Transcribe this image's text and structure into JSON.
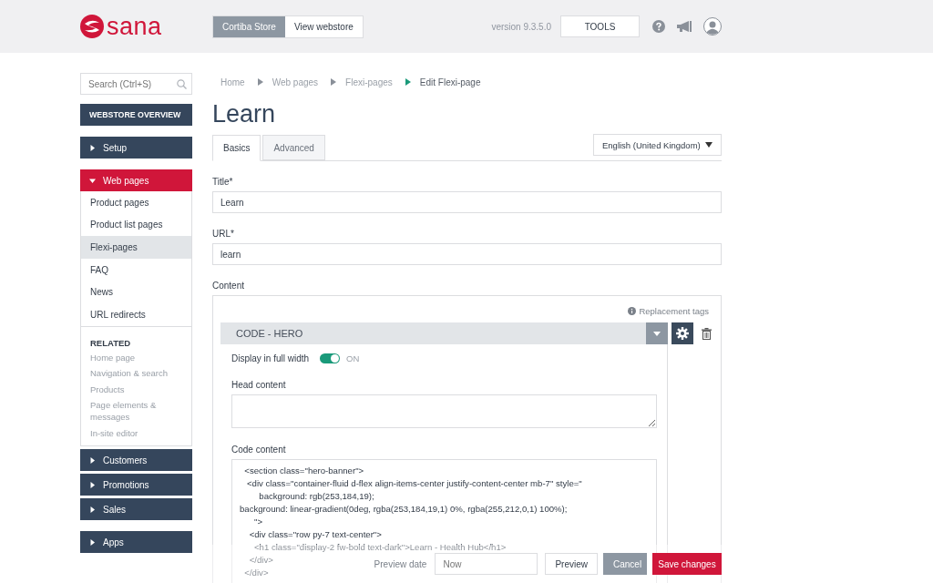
{
  "header": {
    "logo": "sana",
    "store_switch": [
      {
        "label": "Cortiba Store",
        "selected": true
      },
      {
        "label": "View webstore",
        "selected": false
      }
    ],
    "version": "version 9.3.5.0",
    "tools": "TOOLS"
  },
  "sidebar": {
    "search": {
      "placeholder": "Search (Ctrl+S)"
    },
    "overview": "WEBSTORE OVERVIEW",
    "sections": [
      {
        "label": "Setup",
        "expanded": false
      },
      {
        "label": "Web pages",
        "expanded": true,
        "children": [
          {
            "label": "Product pages",
            "selected": false
          },
          {
            "label": "Product list pages",
            "selected": false
          },
          {
            "label": "Flexi-pages",
            "selected": true
          },
          {
            "label": "FAQ",
            "selected": false
          },
          {
            "label": "News",
            "selected": false
          },
          {
            "label": "URL redirects",
            "selected": false
          }
        ],
        "related": {
          "heading": "RELATED",
          "links": [
            "Home page",
            "Navigation & search",
            "Products",
            "Page elements & messages",
            "In-site editor"
          ]
        }
      },
      {
        "label": "Customers",
        "expanded": false
      },
      {
        "label": "Promotions",
        "expanded": false
      },
      {
        "label": "Sales",
        "expanded": false
      }
    ],
    "apps": {
      "label": "Apps",
      "expanded": false
    }
  },
  "breadcrumb": [
    "Home",
    "Web pages",
    "Flexi-pages",
    "Edit Flexi-page"
  ],
  "page_title": "Learn",
  "tabs": [
    {
      "label": "Basics",
      "selected": true
    },
    {
      "label": "Advanced",
      "selected": false
    }
  ],
  "language": "English (United Kingdom)",
  "fields": [
    {
      "label": "Title*",
      "value": "Learn"
    },
    {
      "label": "URL*",
      "value": "learn"
    }
  ],
  "content": {
    "label": "Content",
    "replacement_tags": "Replacement tags",
    "block": {
      "title": "CODE - HERO",
      "full_width": {
        "label": "Display in full width",
        "on": true,
        "state_text": "ON"
      },
      "head_label": "Head content",
      "code_label": "Code content",
      "code_lines": [
        "  <section class=\"hero-banner\">",
        "   <div class=\"container-fluid d-flex align-items-center justify-content-center mb-7\" style=\"",
        "        background: rgb(253,184,19);",
        "background: linear-gradient(0deg, rgba(253,184,19,1) 0%, rgba(255,212,0,1) 100%);",
        "      \">",
        "    <div class=\"row py-7 text-center\">",
        "      <h1 class=\"display-2 fw-bold text-dark\">Learn - Health Hub</h1>",
        "    </div>",
        "  </div>"
      ]
    }
  },
  "footer": {
    "preview_date_label": "Preview date",
    "preview_date": {
      "placeholder": "Now"
    },
    "buttons": [
      {
        "label": "Preview",
        "kind": "default"
      },
      {
        "label": "Cancel",
        "kind": "muted"
      },
      {
        "label": "Save changes",
        "kind": "primary"
      }
    ]
  }
}
